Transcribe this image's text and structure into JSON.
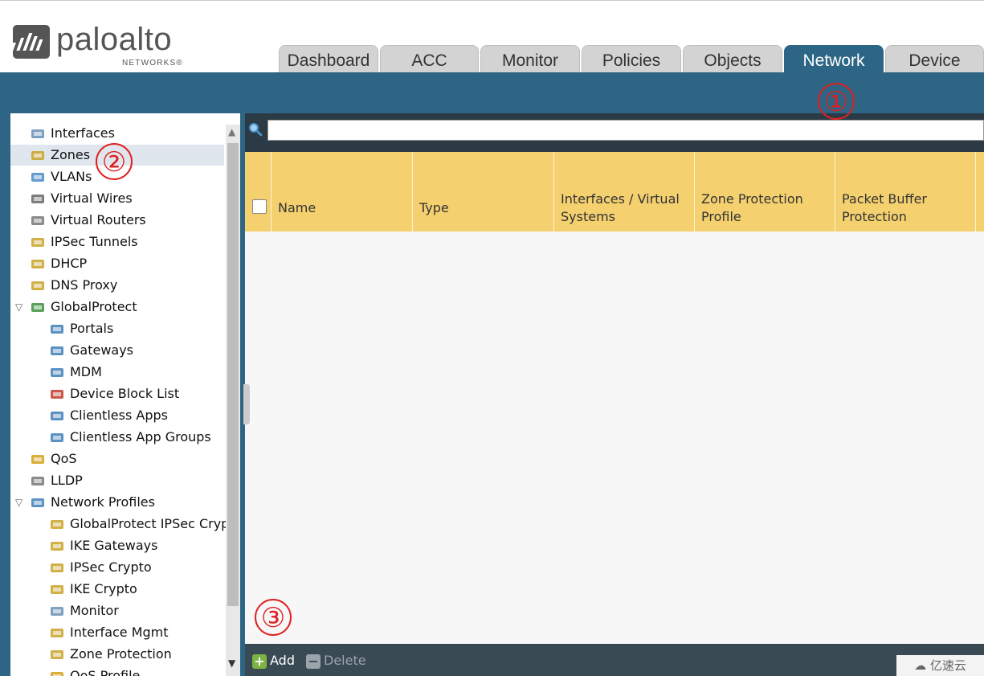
{
  "header": {
    "logo_text": "paloalto",
    "logo_sub": "NETWORKS®",
    "tabs": [
      {
        "label": "Dashboard"
      },
      {
        "label": "ACC"
      },
      {
        "label": "Monitor"
      },
      {
        "label": "Policies"
      },
      {
        "label": "Objects"
      },
      {
        "label": "Network",
        "active": true
      },
      {
        "label": "Device"
      }
    ]
  },
  "sidebar": {
    "items": [
      {
        "label": "Interfaces",
        "icon": "interfaces-icon"
      },
      {
        "label": "Zones",
        "icon": "zones-icon",
        "selected": true
      },
      {
        "label": "VLANs",
        "icon": "vlans-icon"
      },
      {
        "label": "Virtual Wires",
        "icon": "virtual-wires-icon"
      },
      {
        "label": "Virtual Routers",
        "icon": "virtual-routers-icon"
      },
      {
        "label": "IPSec Tunnels",
        "icon": "ipsec-tunnels-icon"
      },
      {
        "label": "DHCP",
        "icon": "dhcp-icon"
      },
      {
        "label": "DNS Proxy",
        "icon": "dns-proxy-icon"
      },
      {
        "label": "GlobalProtect",
        "icon": "globalprotect-icon",
        "expanded": true
      },
      {
        "label": "Portals",
        "icon": "portals-icon"
      },
      {
        "label": "Gateways",
        "icon": "gateways-icon"
      },
      {
        "label": "MDM",
        "icon": "mdm-icon"
      },
      {
        "label": "Device Block List",
        "icon": "device-block-list-icon"
      },
      {
        "label": "Clientless Apps",
        "icon": "clientless-apps-icon"
      },
      {
        "label": "Clientless App Groups",
        "icon": "clientless-app-groups-icon"
      },
      {
        "label": "QoS",
        "icon": "qos-icon"
      },
      {
        "label": "LLDP",
        "icon": "lldp-icon"
      },
      {
        "label": "Network Profiles",
        "icon": "network-profiles-icon",
        "expanded": true
      },
      {
        "label": "GlobalProtect IPSec Crypto",
        "icon": "lock-icon"
      },
      {
        "label": "IKE Gateways",
        "icon": "ike-gateways-icon"
      },
      {
        "label": "IPSec Crypto",
        "icon": "lock-icon"
      },
      {
        "label": "IKE Crypto",
        "icon": "lock-icon"
      },
      {
        "label": "Monitor",
        "icon": "monitor-profile-icon"
      },
      {
        "label": "Interface Mgmt",
        "icon": "interface-mgmt-icon"
      },
      {
        "label": "Zone Protection",
        "icon": "zone-protection-icon"
      },
      {
        "label": "QoS Profile",
        "icon": "qos-profile-icon"
      }
    ]
  },
  "table": {
    "columns": [
      {
        "label": "Name"
      },
      {
        "label": "Type"
      },
      {
        "label": "Interfaces / Virtual Systems"
      },
      {
        "label": "Zone Protection Profile"
      },
      {
        "label": "Packet Buffer Protection"
      }
    ],
    "rows": []
  },
  "footer": {
    "add_label": "Add",
    "delete_label": "Delete"
  },
  "annotations": [
    "①",
    "②",
    "③"
  ],
  "watermark": "亿速云",
  "colors": {
    "accent_blue": "#2e6584",
    "header_yellow": "#f4d06f",
    "annotation_red": "#e02020"
  }
}
